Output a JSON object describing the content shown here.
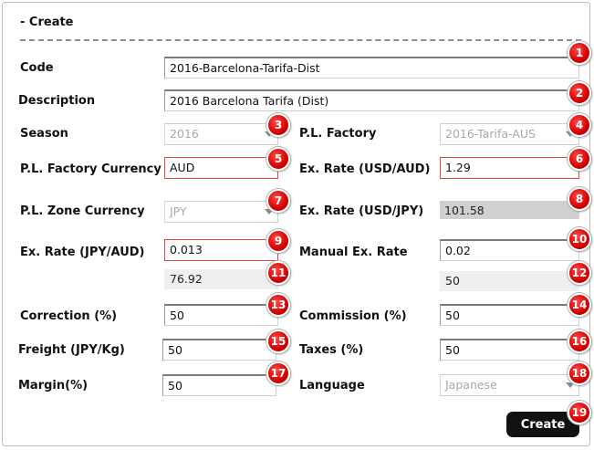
{
  "section": {
    "title": "- Create"
  },
  "fields": {
    "code": {
      "label": "Code",
      "value": "2016-Barcelona-Tarifa-Dist",
      "badge": "1"
    },
    "description": {
      "label": "Description",
      "value": "2016 Barcelona Tarifa (Dist)",
      "badge": "2"
    },
    "season": {
      "label": "Season",
      "value": "2016",
      "badge": "3"
    },
    "pl_factory": {
      "label": "P.L. Factory",
      "value": "2016-Tarifa-AUS",
      "badge": "4"
    },
    "pl_factory_currency": {
      "label": "P.L. Factory Currency",
      "value": "AUD",
      "badge": "5"
    },
    "ex_rate_usd_aud": {
      "label": "Ex. Rate (USD/AUD)",
      "value": "1.29",
      "badge": "6"
    },
    "pl_zone_currency": {
      "label": "P.L. Zone Currency",
      "value": "JPY",
      "badge": "7"
    },
    "ex_rate_usd_jpy": {
      "label": "Ex. Rate (USD/JPY)",
      "value": "101.58",
      "badge": "8"
    },
    "ex_rate_jpy_aud": {
      "label": "Ex. Rate (JPY/AUD)",
      "value": "0.013",
      "badge": "9"
    },
    "manual_ex_rate": {
      "label": "Manual Ex. Rate",
      "value": "0.02",
      "badge": "10"
    },
    "computed_left": {
      "value": "76.92",
      "badge": "11"
    },
    "computed_right": {
      "value": "50",
      "badge": "12"
    },
    "correction": {
      "label": "Correction (%)",
      "value": "50",
      "badge": "13"
    },
    "commission": {
      "label": "Commission (%)",
      "value": "50",
      "badge": "14"
    },
    "freight": {
      "label": "Freight (JPY/Kg)",
      "value": "50",
      "badge": "15"
    },
    "taxes": {
      "label": "Taxes (%)",
      "value": "50",
      "badge": "16"
    },
    "margin": {
      "label": "Margin(%)",
      "value": "50",
      "badge": "17"
    },
    "language": {
      "label": "Language",
      "value": "Japanese",
      "badge": "18"
    }
  },
  "actions": {
    "create_label": "Create",
    "create_badge": "19"
  },
  "colors": {
    "badge": "#d40000",
    "error_border": "#e44444",
    "button": "#111111"
  }
}
